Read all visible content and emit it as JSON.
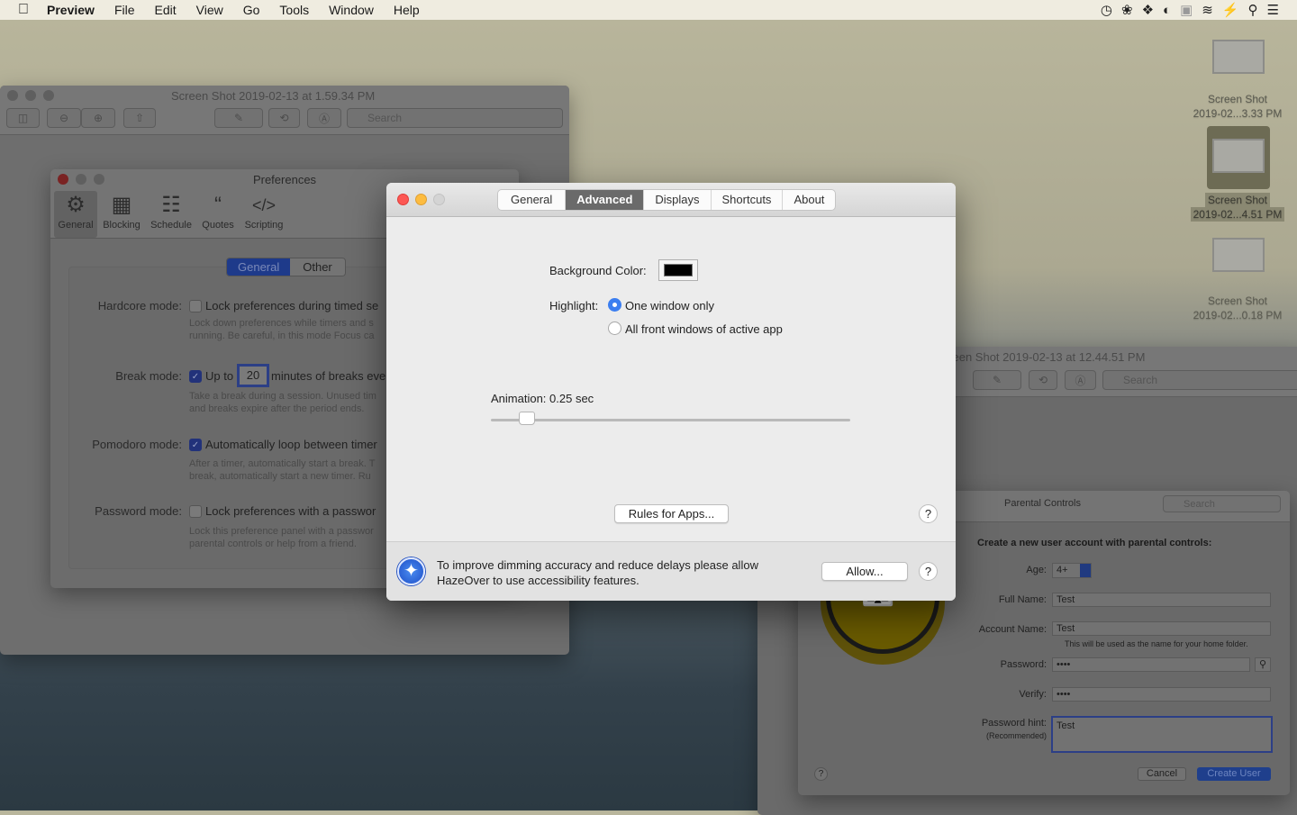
{
  "menubar": {
    "apple": "",
    "app": "Preview",
    "items": [
      "File",
      "Edit",
      "View",
      "Go",
      "Tools",
      "Window",
      "Help"
    ],
    "tray_icons": [
      "clock-icon",
      "aperture-icon",
      "dropbox-icon",
      "focus-icon",
      "drive-icon",
      "wifi-icon",
      "battery-charging-icon",
      "spotlight-search-icon",
      "notification-list-icon"
    ]
  },
  "desktop": {
    "icons": [
      {
        "line1": "Screen Shot",
        "line2": "2019-02...3.33 PM"
      },
      {
        "line1": "Screen Shot",
        "line2": "2019-02...4.51 PM",
        "selected": true
      },
      {
        "line1": "Screen Shot",
        "line2": "2019-02...0.18 PM"
      }
    ]
  },
  "preview_left": {
    "title": "Screen Shot 2019-02-13 at 1.59.34 PM",
    "search_placeholder": "Search"
  },
  "focus_prefs": {
    "title": "Preferences",
    "toolbar": [
      "General",
      "Blocking",
      "Schedule",
      "Quotes",
      "Scripting"
    ],
    "tabs": [
      "General",
      "Other"
    ],
    "rows": [
      {
        "label": "Hardcore mode:",
        "checked": false,
        "text": "Lock preferences during timed se",
        "sub1": "Lock down preferences while timers and s",
        "sub2": "running. Be careful, in this mode Focus ca"
      },
      {
        "label": "Break mode:",
        "checked": true,
        "text_pre": "Up to",
        "value": "20",
        "text": "minutes of breaks eve",
        "sub1": "Take a break during a session. Unused tim",
        "sub2": "and breaks expire after the period ends."
      },
      {
        "label": "Pomodoro mode:",
        "checked": true,
        "text": "Automatically loop between timer",
        "sub1": "After a timer, automatically start a break. T",
        "sub2": "break, automatically start a new timer. Ru"
      },
      {
        "label": "Password mode:",
        "checked": false,
        "text": "Lock preferences with a passwor",
        "sub1": "Lock this preference panel with a passwor",
        "sub2": "parental controls or help from a friend."
      }
    ]
  },
  "preview_right": {
    "title": "Screen Shot 2019-02-13 at 12.44.51 PM",
    "search_placeholder": "Search"
  },
  "parental": {
    "title": "Parental Controls",
    "search_placeholder": "Search",
    "heading": "Create a new user account with parental controls:",
    "age_label": "Age:",
    "age": "4+",
    "full_name_label": "Full Name:",
    "full_name": "Test",
    "account_label": "Account Name:",
    "account": "Test",
    "account_hint": "This will be used as the name for your home folder.",
    "password_label": "Password:",
    "password": "••••",
    "verify_label": "Verify:",
    "verify": "••••",
    "hint_label": "Password hint:",
    "hint_sub": "(Recommended)",
    "hint": "Test",
    "cancel": "Cancel",
    "create": "Create User",
    "help": "?"
  },
  "hazeover": {
    "tabs": [
      "General",
      "Advanced",
      "Displays",
      "Shortcuts",
      "About"
    ],
    "active_tab": "Advanced",
    "bg_color_label": "Background Color:",
    "bg_color": "#000000",
    "highlight_label": "Highlight:",
    "highlight_options": [
      "One window only",
      "All front windows of active app"
    ],
    "highlight_selected": 0,
    "animation_label": "Animation: 0.25 sec",
    "animation_fraction": 0.1,
    "rules_button": "Rules for Apps...",
    "help": "?",
    "notice_line1": "To improve dimming accuracy and reduce delays please allow",
    "notice_line2": "HazeOver to use accessibility features.",
    "allow_button": "Allow..."
  }
}
